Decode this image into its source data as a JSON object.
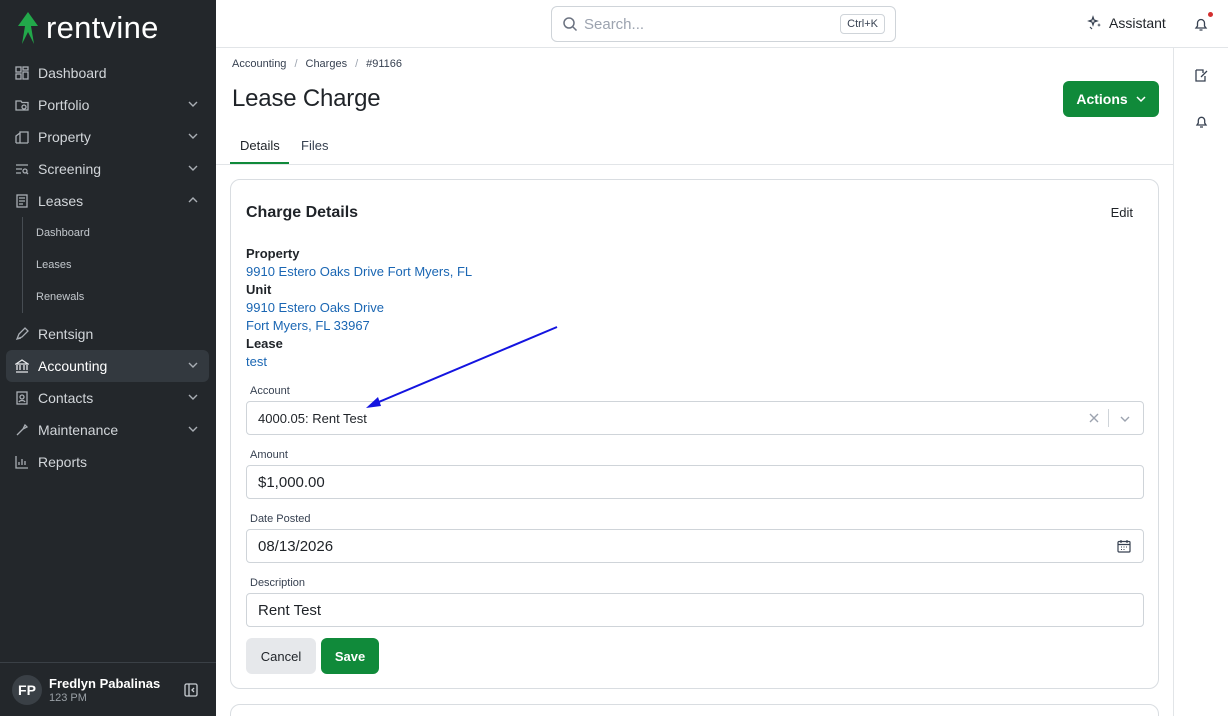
{
  "brand": {
    "name": "rentvine"
  },
  "sidebar": {
    "items": [
      {
        "label": "Dashboard",
        "icon": "dashboard-icon"
      },
      {
        "label": "Portfolio",
        "icon": "portfolio-icon"
      },
      {
        "label": "Property",
        "icon": "property-icon"
      },
      {
        "label": "Screening",
        "icon": "screening-icon"
      },
      {
        "label": "Leases",
        "icon": "leases-icon"
      },
      {
        "label": "Rentsign",
        "icon": "rentsign-icon"
      },
      {
        "label": "Accounting",
        "icon": "accounting-icon"
      },
      {
        "label": "Contacts",
        "icon": "contacts-icon"
      },
      {
        "label": "Maintenance",
        "icon": "maintenance-icon"
      },
      {
        "label": "Reports",
        "icon": "reports-icon"
      }
    ],
    "leases_sub": [
      "Dashboard",
      "Leases",
      "Renewals"
    ],
    "active": "Accounting"
  },
  "user": {
    "initials": "FP",
    "name": "Fredlyn Pabalinas",
    "subtitle": "123 PM"
  },
  "topbar": {
    "search_placeholder": "Search...",
    "shortcut": "Ctrl+K",
    "assistant_label": "Assistant"
  },
  "breadcrumb": [
    "Accounting",
    "Charges",
    "#91166"
  ],
  "page": {
    "title": "Lease Charge",
    "actions_label": "Actions"
  },
  "tabs": [
    {
      "label": "Details"
    },
    {
      "label": "Files"
    }
  ],
  "card": {
    "title": "Charge Details",
    "edit_label": "Edit",
    "property_label": "Property",
    "property_value": "9910 Estero Oaks Drive Fort Myers, FL",
    "unit_label": "Unit",
    "unit_line1": "9910 Estero Oaks Drive",
    "unit_line2": "Fort Myers, FL 33967",
    "lease_label": "Lease",
    "lease_value": "test",
    "account_label": "Account",
    "account_value": "4000.05: Rent Test",
    "amount_label": "Amount",
    "amount_value": "$1,000.00",
    "date_label": "Date Posted",
    "date_value": "08/13/2026",
    "description_label": "Description",
    "description_value": "Rent Test",
    "cancel_label": "Cancel",
    "save_label": "Save"
  },
  "colors": {
    "primary": "#108a3a",
    "sidebar_bg": "#23272b",
    "link": "#1a66b3",
    "annotation_arrow": "#1414e0"
  }
}
